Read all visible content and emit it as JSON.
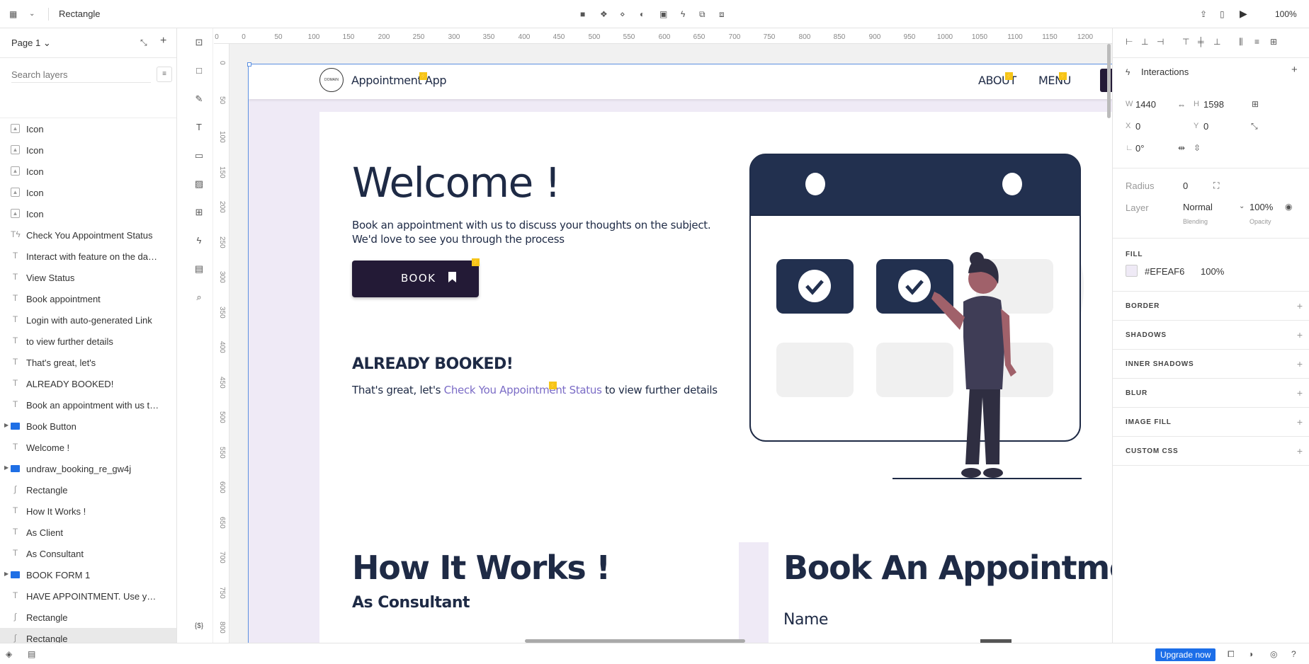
{
  "topbar": {
    "title": "Rectangle",
    "zoom": "100%",
    "icons": [
      "grid-menu-icon",
      "chevron-down-icon",
      "folder-icon",
      "component-icon",
      "symbol-icon",
      "mask-icon",
      "layout-icon",
      "lightning-icon",
      "boolean-icon",
      "link-icon",
      "export-icon",
      "device-icon",
      "play-icon"
    ]
  },
  "layers_panel": {
    "page": "Page 1",
    "page_caret": "⌄",
    "search_placeholder": "Search layers",
    "items": [
      {
        "name": "Icon",
        "kind": "image"
      },
      {
        "name": "Icon",
        "kind": "image"
      },
      {
        "name": "Icon",
        "kind": "image"
      },
      {
        "name": "Icon",
        "kind": "image"
      },
      {
        "name": "Icon",
        "kind": "image"
      },
      {
        "name": "Check You Appointment Status",
        "kind": "text-interaction"
      },
      {
        "name": "Interact with feature on the dashboard",
        "kind": "text"
      },
      {
        "name": "View Status",
        "kind": "text"
      },
      {
        "name": "Book appointment",
        "kind": "text"
      },
      {
        "name": "Login with auto-generated Link",
        "kind": "text"
      },
      {
        "name": "to view further details",
        "kind": "text"
      },
      {
        "name": "That's great, let's",
        "kind": "text"
      },
      {
        "name": "ALREADY BOOKED!",
        "kind": "text"
      },
      {
        "name": "Book an appointment with us to discuss",
        "kind": "text"
      },
      {
        "name": "Book Button",
        "kind": "group"
      },
      {
        "name": "Welcome !",
        "kind": "text"
      },
      {
        "name": "undraw_booking_re_gw4j",
        "kind": "group"
      },
      {
        "name": "Rectangle",
        "kind": "path"
      },
      {
        "name": "How It Works !",
        "kind": "text"
      },
      {
        "name": "As Client",
        "kind": "text"
      },
      {
        "name": "As Consultant",
        "kind": "text"
      },
      {
        "name": "BOOK FORM 1",
        "kind": "group"
      },
      {
        "name": "HAVE APPOINTMENT. Use your link",
        "kind": "text"
      },
      {
        "name": "Rectangle",
        "kind": "path"
      },
      {
        "name": "Rectangle",
        "kind": "path",
        "selected": true
      }
    ]
  },
  "rulers": {
    "h": [
      "0",
      "0",
      "50",
      "100",
      "150",
      "200",
      "250",
      "300",
      "350",
      "400",
      "450",
      "500",
      "550",
      "600",
      "650",
      "700",
      "750",
      "800",
      "850",
      "900",
      "950",
      "1000",
      "1050",
      "1100",
      "1150",
      "1200"
    ],
    "v": [
      "0",
      "50",
      "100",
      "150",
      "200",
      "250",
      "300",
      "350",
      "400",
      "450",
      "500",
      "550",
      "600",
      "650",
      "700",
      "750",
      "800"
    ]
  },
  "artboard": {
    "nav": {
      "logo_text": "DOMAIN",
      "brand": "Appointment App",
      "links": [
        "ABOUT",
        "MENU"
      ],
      "bolt": "⚡"
    },
    "hero": {
      "title": "Welcome !",
      "intro": "Book an appointment with us to discuss your thoughts on the subject. We'd love to see you through the process",
      "book_label": "BOOK",
      "already": "ALREADY BOOKED!",
      "status_pre": "That's great, let's ",
      "status_link": "Check You Appointment Status",
      "status_post": " to view further details"
    },
    "how": {
      "title": "How It Works !",
      "subtitle": "As Consultant"
    },
    "book_form": {
      "title": "Book An Appointment",
      "field": "Name"
    },
    "colors": {
      "navy": "#1e2a45",
      "button": "#231a36",
      "bg": "#efeaf6",
      "link": "#7b6cc6",
      "gray": "#f0f0f0",
      "skin": "#a0616a",
      "shirt": "#3f3d56"
    }
  },
  "inspector": {
    "header": "Interactions",
    "w_label": "W",
    "w": "1440",
    "h_label": "H",
    "h": "1598",
    "x_label": "X",
    "x": "0",
    "y_label": "Y",
    "y": "0",
    "rot_label": "∟",
    "rotation": "0°",
    "radius_label": "Radius",
    "radius": "0",
    "layer_label": "Layer",
    "blend": "Normal",
    "blend_caption": "Blending",
    "opacity": "100%",
    "opacity_caption": "Opacity",
    "fill_label": "FILL",
    "fill_hex": "#EFEAF6",
    "fill_opacity": "100%",
    "sections": [
      "BORDER",
      "SHADOWS",
      "INNER SHADOWS",
      "BLUR",
      "IMAGE FILL",
      "CUSTOM CSS"
    ]
  },
  "statusbar": {
    "upgrade": "Upgrade now",
    "var_icon": "{$}"
  }
}
